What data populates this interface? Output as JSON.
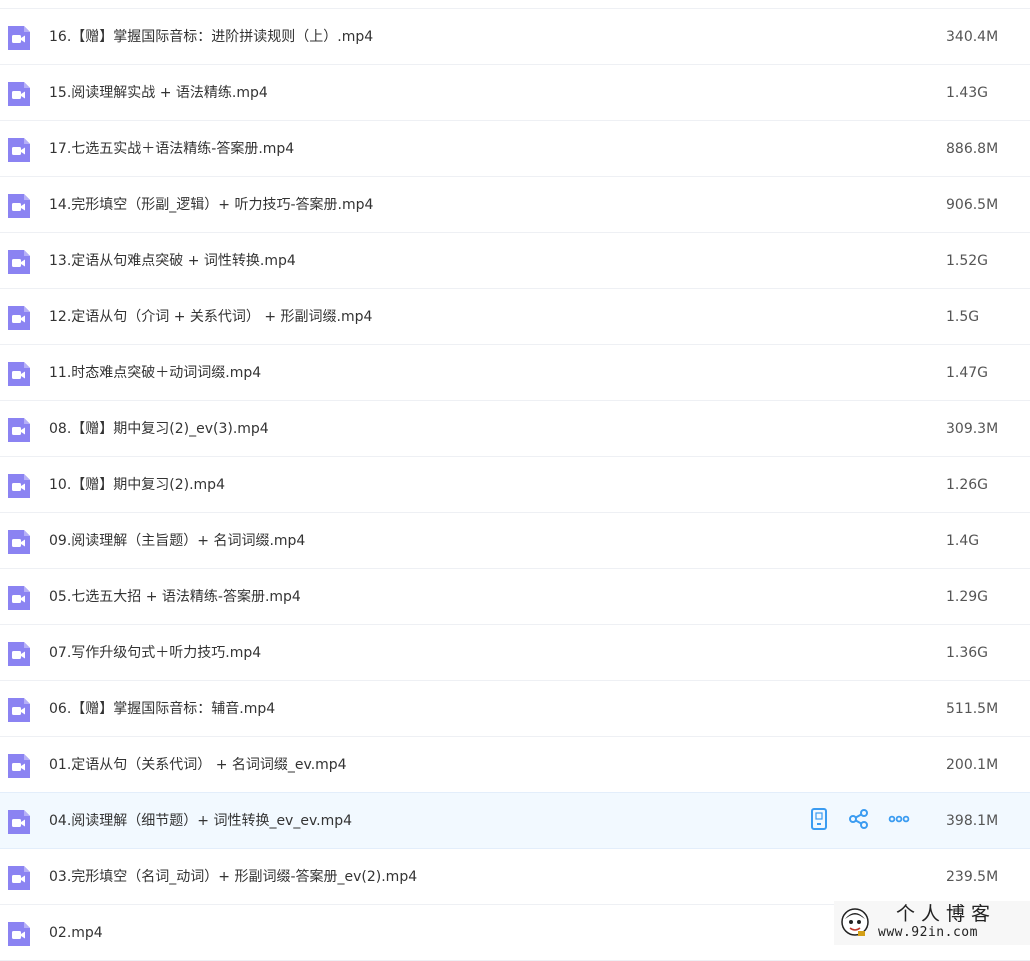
{
  "files": [
    {
      "name": "16.【赠】掌握国际音标：进阶拼读规则（上）.mp4",
      "size": "340.4M"
    },
    {
      "name": "15.阅读理解实战 + 语法精练.mp4",
      "size": "1.43G"
    },
    {
      "name": "17.七选五实战＋语法精练-答案册.mp4",
      "size": "886.8M"
    },
    {
      "name": "14.完形填空（形副_逻辑）+ 听力技巧-答案册.mp4",
      "size": "906.5M"
    },
    {
      "name": "13.定语从句难点突破 + 词性转换.mp4",
      "size": "1.52G"
    },
    {
      "name": "12.定语从句（介词 + 关系代词） + 形副词缀.mp4",
      "size": "1.5G"
    },
    {
      "name": "11.时态难点突破＋动词词缀.mp4",
      "size": "1.47G"
    },
    {
      "name": "08.【赠】期中复习(2)_ev(3).mp4",
      "size": "309.3M"
    },
    {
      "name": "10.【赠】期中复习(2).mp4",
      "size": "1.26G"
    },
    {
      "name": "09.阅读理解（主旨题）+ 名词词缀.mp4",
      "size": "1.4G"
    },
    {
      "name": "05.七选五大招 + 语法精练-答案册.mp4",
      "size": "1.29G"
    },
    {
      "name": "07.写作升级句式＋听力技巧.mp4",
      "size": "1.36G"
    },
    {
      "name": "06.【赠】掌握国际音标：辅音.mp4",
      "size": "511.5M"
    },
    {
      "name": "01.定语从句（关系代词） + 名词词缀_ev.mp4",
      "size": "200.1M"
    },
    {
      "name": "04.阅读理解（细节题）+ 词性转换_ev_ev.mp4",
      "size": "398.1M"
    },
    {
      "name": "03.完形填空（名词_动词）+ 形副词缀-答案册_ev(2).mp4",
      "size": "239.5M"
    },
    {
      "name": "02.mp4",
      "size": ""
    }
  ],
  "hovered_index": 14,
  "row_actions": [
    "phone-icon",
    "share-icon",
    "more-icon"
  ],
  "watermark": {
    "title": "个人博客",
    "url": "www.92in.com"
  },
  "colors": {
    "icon": "#8b83f2",
    "action": "#3b9cf1",
    "hover_bg": "#f2f9ff"
  }
}
